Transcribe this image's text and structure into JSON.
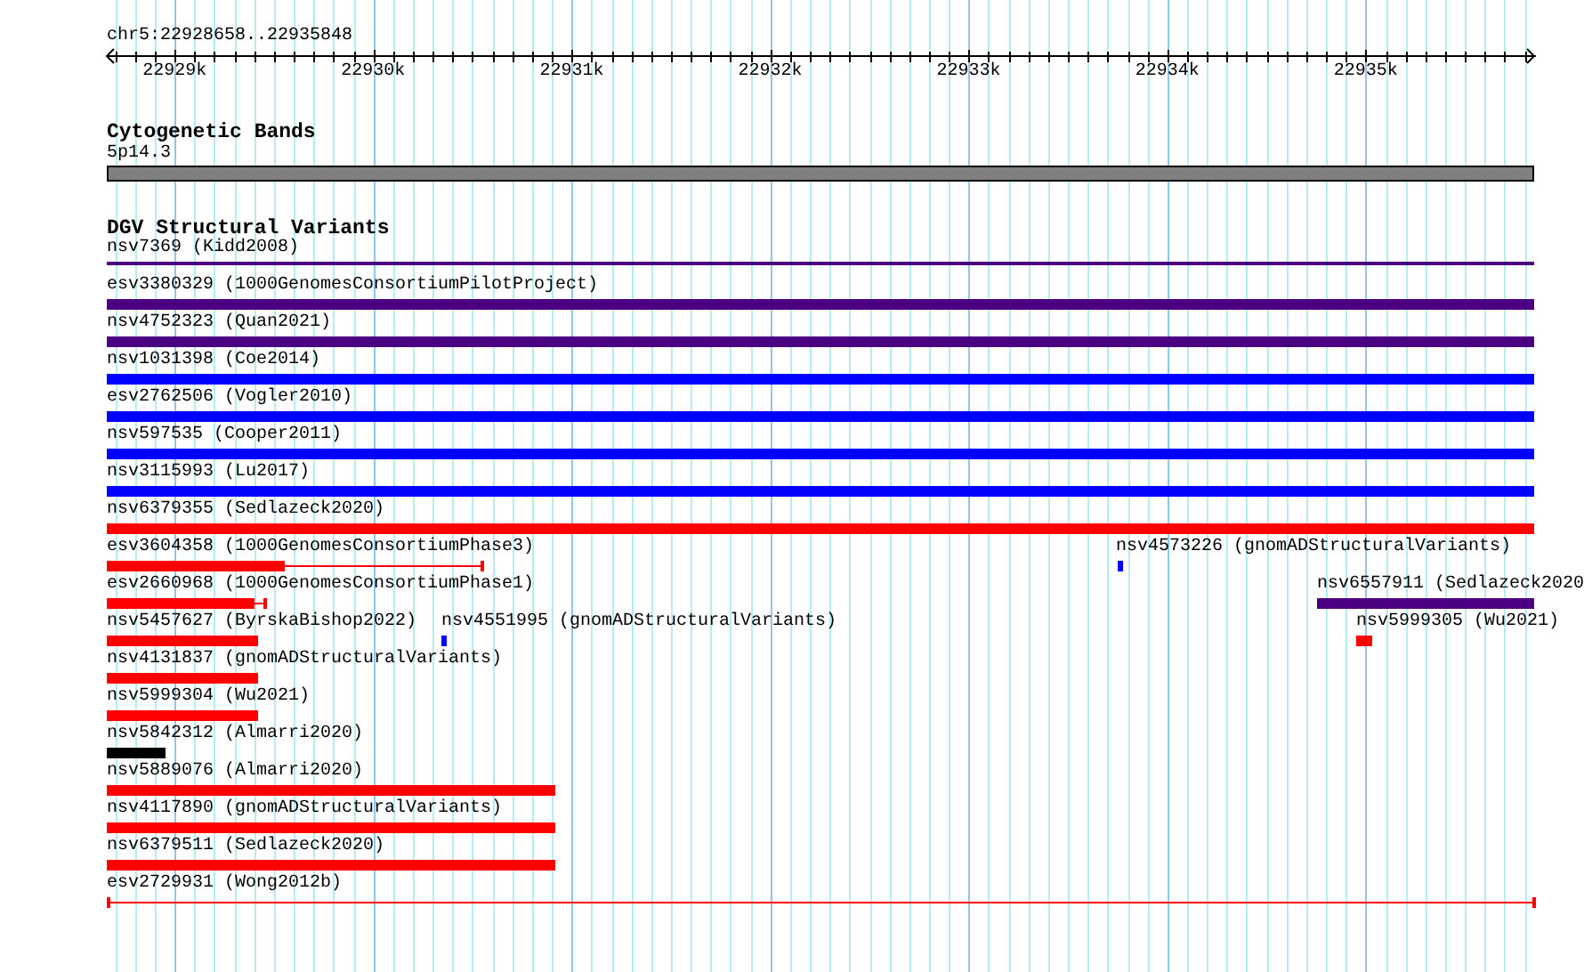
{
  "ruler": {
    "location": "chr5:22928658..22935848",
    "ticks": [
      "22929k",
      "22930k",
      "22931k",
      "22932k",
      "22933k",
      "22934k",
      "22935k"
    ]
  },
  "tracks": [
    {
      "title": "Cytogenetic Bands",
      "features": [
        {
          "label": "5p14.3",
          "color": "#808080",
          "kind": "band"
        }
      ]
    },
    {
      "title": "DGV Structural Variants",
      "features": [
        {
          "label": "nsv7369 (Kidd2008)",
          "color": "#4b0082",
          "kind": "line"
        },
        {
          "label": "esv3380329 (1000GenomesConsortiumPilotProject)",
          "color": "#4b0082",
          "kind": "bar"
        },
        {
          "label": "nsv4752323 (Quan2021)",
          "color": "#4b0082",
          "kind": "bar"
        },
        {
          "label": "nsv1031398 (Coe2014)",
          "color": "#0000ff",
          "kind": "bar"
        },
        {
          "label": "esv2762506 (Vogler2010)",
          "color": "#0000ff",
          "kind": "bar"
        },
        {
          "label": "nsv597535 (Cooper2011)",
          "color": "#0000ff",
          "kind": "bar"
        },
        {
          "label": "nsv3115993 (Lu2017)",
          "color": "#0000ff",
          "kind": "bar"
        },
        {
          "label": "nsv6379355 (Sedlazeck2020)",
          "color": "#ff0000",
          "kind": "bar"
        },
        {
          "label": "esv3604358 (1000GenomesConsortiumPhase3)",
          "color": "#ff0000",
          "kind": "bar-line"
        },
        {
          "label": "nsv4573226 (gnomADStructuralVariants)",
          "color": "#0000ff",
          "kind": "bar"
        },
        {
          "label": "esv2660968 (1000GenomesConsortiumPhase1)",
          "color": "#ff0000",
          "kind": "bar-line"
        },
        {
          "label": "nsv6557911 (Sedlazeck2020",
          "color": "#4b0082",
          "kind": "bar"
        },
        {
          "label": "nsv5457627 (ByrskaBishop2022)",
          "color": "#ff0000",
          "kind": "bar"
        },
        {
          "label": "nsv4551995 (gnomADStructuralVariants)",
          "color": "#0000ff",
          "kind": "bar"
        },
        {
          "label": "nsv5999305 (Wu2021)",
          "color": "#ff0000",
          "kind": "bar"
        },
        {
          "label": "nsv4131837 (gnomADStructuralVariants)",
          "color": "#ff0000",
          "kind": "bar"
        },
        {
          "label": "nsv5999304 (Wu2021)",
          "color": "#ff0000",
          "kind": "bar"
        },
        {
          "label": "nsv5842312 (Almarri2020)",
          "color": "#000000",
          "kind": "bar"
        },
        {
          "label": "nsv5889076 (Almarri2020)",
          "color": "#ff0000",
          "kind": "bar"
        },
        {
          "label": "nsv4117890 (gnomADStructuralVariants)",
          "color": "#ff0000",
          "kind": "bar"
        },
        {
          "label": "nsv6379511 (Sedlazeck2020)",
          "color": "#ff0000",
          "kind": "bar"
        },
        {
          "label": "esv2729931 (Wong2012b)",
          "color": "#ff0000",
          "kind": "capped-line"
        }
      ]
    }
  ]
}
